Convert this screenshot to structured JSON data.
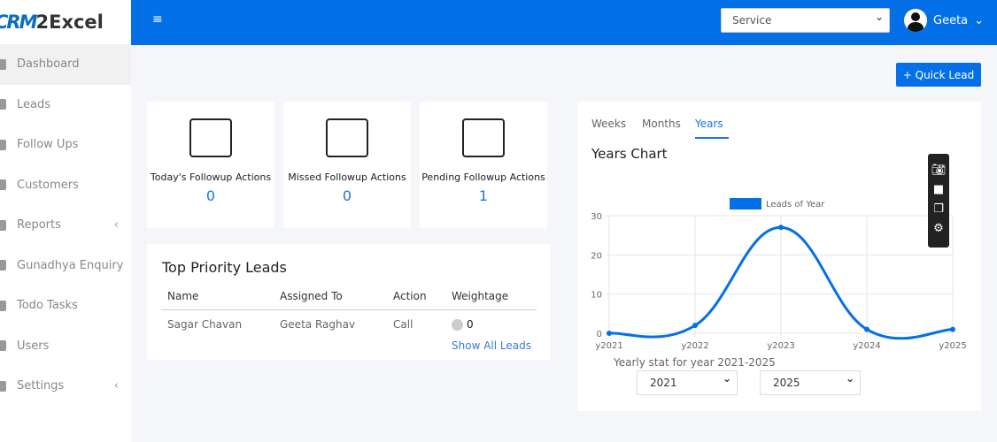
{
  "brand": {
    "logo_mark": "CRM",
    "logo_text": "2Excel"
  },
  "sidebar": {
    "items": [
      {
        "label": "Dashboard",
        "icon": "home-icon",
        "active": true
      },
      {
        "label": "Leads",
        "icon": "user-tie-icon"
      },
      {
        "label": "Follow Ups",
        "icon": "comment-icon"
      },
      {
        "label": "Customers",
        "icon": "customer-icon"
      },
      {
        "label": "Reports",
        "icon": "file-icon",
        "chevron": "‹"
      },
      {
        "label": "Gunadhya Enquiry",
        "icon": "edit-icon"
      },
      {
        "label": "Todo Tasks",
        "icon": "tasks-icon"
      },
      {
        "label": "Users",
        "icon": "users-icon"
      },
      {
        "label": "Settings",
        "icon": "gear-icon",
        "chevron": "‹"
      }
    ]
  },
  "topbar": {
    "menu_icon": "≡",
    "service_select": "Service",
    "user_name": "Geeta",
    "user_chevron": "⌄"
  },
  "quick_lead": "+ Quick Lead",
  "stats": [
    {
      "label": "Today's Followup Actions",
      "value": "0",
      "icon": "calendar-bell-icon"
    },
    {
      "label": "Missed Followup Actions",
      "value": "0",
      "icon": "id-card-arrow-icon"
    },
    {
      "label": "Pending Followup Actions",
      "value": "1",
      "icon": "checklist-hourglass-icon"
    }
  ],
  "top_leads": {
    "title": "Top Priority Leads",
    "columns": [
      "Name",
      "Assigned To",
      "Action",
      "Weightage"
    ],
    "rows": [
      {
        "name": "Sagar Chavan",
        "assigned": "Geeta Raghav",
        "action": "Call",
        "weightage": "0"
      }
    ],
    "show_all": "Show All Leads"
  },
  "chart_panel": {
    "tabs": [
      "Weeks",
      "Months",
      "Years"
    ],
    "active_tab": "Years",
    "title": "Years Chart",
    "stat_label": "Yearly stat for year 2021-2025",
    "from": "2021",
    "to": "2025"
  },
  "toolbar_icons": [
    "camera-icon",
    "video-icon",
    "copy-icon",
    "gear-icon"
  ],
  "colors": {
    "primary": "#0470e8",
    "line": "#0470e8"
  },
  "chart_data": {
    "type": "line",
    "categories": [
      "y2021",
      "y2022",
      "y2023",
      "y2024",
      "y2025"
    ],
    "series": [
      {
        "name": "Leads of Year",
        "values": [
          0,
          2,
          27,
          1,
          1
        ]
      }
    ],
    "ylim": [
      0,
      30
    ],
    "yticks": [
      0,
      10,
      20,
      30
    ],
    "grid": true,
    "legend": "top",
    "smooth": true
  }
}
